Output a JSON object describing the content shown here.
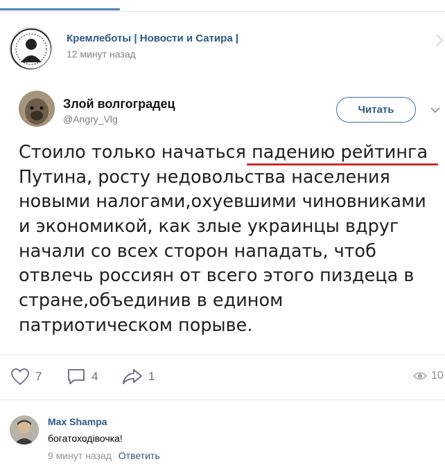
{
  "post": {
    "group_name": "Кремлеботы | Новости и Сатира |",
    "time": "12 минут назад"
  },
  "tweet": {
    "author_name": "Злой волгоградец",
    "handle": "@Angry_Vlg",
    "follow_label": "Читать",
    "text_lines": [
      "Стоило только начаться падению рейтинга",
      "Путина, росту недовольства населения",
      "новыми налогами,охуевшими чиновниками",
      "и экономикой, как злые украинцы вдруг",
      "начали со всех сторон нападать, чтоб",
      "отвлечь россиян от всего этого пиздеца в",
      "стране,объединив в едином",
      "патриотическом порыве."
    ]
  },
  "actions": {
    "likes": "7",
    "comments": "4",
    "shares": "1",
    "views": "10"
  },
  "comment": {
    "author": "Max Shampa",
    "text": "богатоходівочка!",
    "time": "9 минут назад",
    "reply_label": "Ответить"
  },
  "colors": {
    "link_blue": "#2a5885",
    "highlight_underline": "#d72626",
    "icon_gray": "#606a78"
  }
}
